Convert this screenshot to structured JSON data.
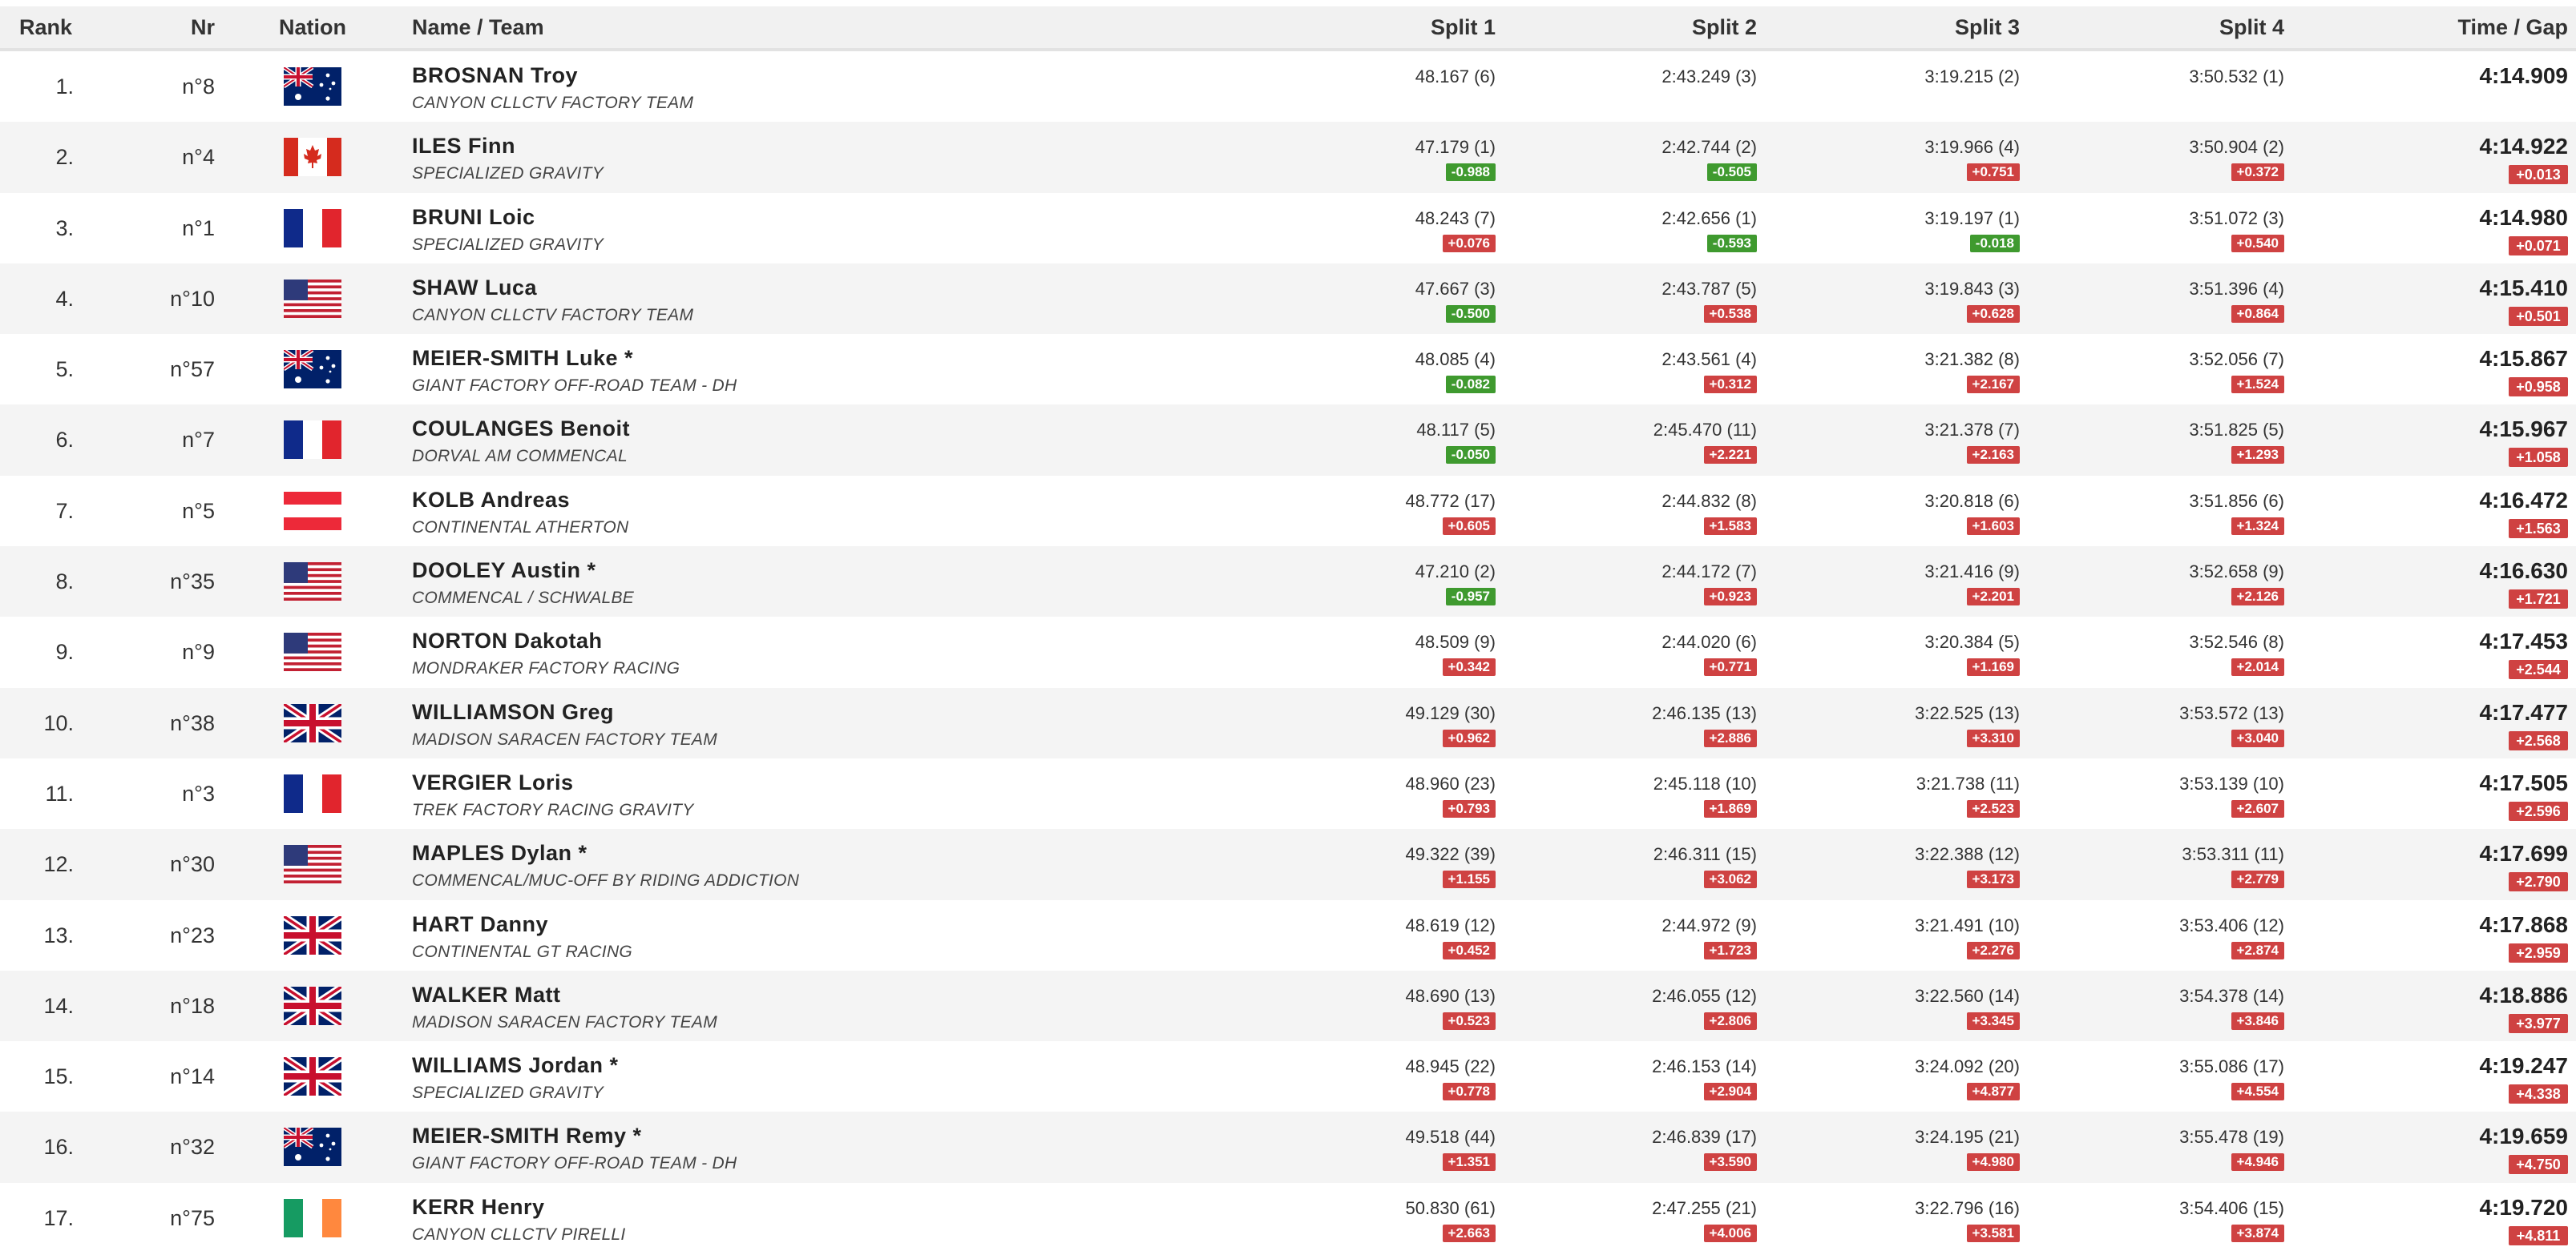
{
  "header": {
    "rank": "Rank",
    "nr": "Nr",
    "nation": "Nation",
    "name_team": "Name / Team",
    "split1": "Split 1",
    "split2": "Split 2",
    "split3": "Split 3",
    "split4": "Split 4",
    "time_gap": "Time / Gap"
  },
  "colors": {
    "gap_negative": "#3f9a2f",
    "gap_positive": "#cf4242",
    "row_alt": "#f4f4f4"
  },
  "rows": [
    {
      "rank": "1.",
      "nr": "n°8",
      "nation": "AUS",
      "name": "BROSNAN Troy",
      "team": "CANYON CLLCTV FACTORY TEAM",
      "s1": "48.167 (6)",
      "g1": "",
      "s2": "2:43.249 (3)",
      "g2": "",
      "s3": "3:19.215 (2)",
      "g3": "",
      "s4": "3:50.532 (1)",
      "g4": "",
      "time": "4:14.909",
      "gap": ""
    },
    {
      "rank": "2.",
      "nr": "n°4",
      "nation": "CAN",
      "name": "ILES Finn",
      "team": "SPECIALIZED GRAVITY",
      "s1": "47.179 (1)",
      "g1": "-0.988",
      "s2": "2:42.744 (2)",
      "g2": "-0.505",
      "s3": "3:19.966 (4)",
      "g3": "+0.751",
      "s4": "3:50.904 (2)",
      "g4": "+0.372",
      "time": "4:14.922",
      "gap": "+0.013"
    },
    {
      "rank": "3.",
      "nr": "n°1",
      "nation": "FRA",
      "name": "BRUNI Loic",
      "team": "SPECIALIZED GRAVITY",
      "s1": "48.243 (7)",
      "g1": "+0.076",
      "s2": "2:42.656 (1)",
      "g2": "-0.593",
      "s3": "3:19.197 (1)",
      "g3": "-0.018",
      "s4": "3:51.072 (3)",
      "g4": "+0.540",
      "time": "4:14.980",
      "gap": "+0.071"
    },
    {
      "rank": "4.",
      "nr": "n°10",
      "nation": "USA",
      "name": "SHAW Luca",
      "team": "CANYON CLLCTV FACTORY TEAM",
      "s1": "47.667 (3)",
      "g1": "-0.500",
      "s2": "2:43.787 (5)",
      "g2": "+0.538",
      "s3": "3:19.843 (3)",
      "g3": "+0.628",
      "s4": "3:51.396 (4)",
      "g4": "+0.864",
      "time": "4:15.410",
      "gap": "+0.501"
    },
    {
      "rank": "5.",
      "nr": "n°57",
      "nation": "AUS",
      "name": "MEIER-SMITH Luke *",
      "team": "GIANT FACTORY OFF-ROAD TEAM - DH",
      "s1": "48.085 (4)",
      "g1": "-0.082",
      "s2": "2:43.561 (4)",
      "g2": "+0.312",
      "s3": "3:21.382 (8)",
      "g3": "+2.167",
      "s4": "3:52.056 (7)",
      "g4": "+1.524",
      "time": "4:15.867",
      "gap": "+0.958"
    },
    {
      "rank": "6.",
      "nr": "n°7",
      "nation": "FRA",
      "name": "COULANGES Benoit",
      "team": "DORVAL AM COMMENCAL",
      "s1": "48.117 (5)",
      "g1": "-0.050",
      "s2": "2:45.470 (11)",
      "g2": "+2.221",
      "s3": "3:21.378 (7)",
      "g3": "+2.163",
      "s4": "3:51.825 (5)",
      "g4": "+1.293",
      "time": "4:15.967",
      "gap": "+1.058"
    },
    {
      "rank": "7.",
      "nr": "n°5",
      "nation": "AUT",
      "name": "KOLB Andreas",
      "team": "CONTINENTAL ATHERTON",
      "s1": "48.772 (17)",
      "g1": "+0.605",
      "s2": "2:44.832 (8)",
      "g2": "+1.583",
      "s3": "3:20.818 (6)",
      "g3": "+1.603",
      "s4": "3:51.856 (6)",
      "g4": "+1.324",
      "time": "4:16.472",
      "gap": "+1.563"
    },
    {
      "rank": "8.",
      "nr": "n°35",
      "nation": "USA",
      "name": "DOOLEY Austin *",
      "team": "COMMENCAL / SCHWALBE",
      "s1": "47.210 (2)",
      "g1": "-0.957",
      "s2": "2:44.172 (7)",
      "g2": "+0.923",
      "s3": "3:21.416 (9)",
      "g3": "+2.201",
      "s4": "3:52.658 (9)",
      "g4": "+2.126",
      "time": "4:16.630",
      "gap": "+1.721"
    },
    {
      "rank": "9.",
      "nr": "n°9",
      "nation": "USA",
      "name": "NORTON Dakotah",
      "team": "MONDRAKER FACTORY RACING",
      "s1": "48.509 (9)",
      "g1": "+0.342",
      "s2": "2:44.020 (6)",
      "g2": "+0.771",
      "s3": "3:20.384 (5)",
      "g3": "+1.169",
      "s4": "3:52.546 (8)",
      "g4": "+2.014",
      "time": "4:17.453",
      "gap": "+2.544"
    },
    {
      "rank": "10.",
      "nr": "n°38",
      "nation": "GBR",
      "name": "WILLIAMSON Greg",
      "team": "MADISON SARACEN FACTORY TEAM",
      "s1": "49.129 (30)",
      "g1": "+0.962",
      "s2": "2:46.135 (13)",
      "g2": "+2.886",
      "s3": "3:22.525 (13)",
      "g3": "+3.310",
      "s4": "3:53.572 (13)",
      "g4": "+3.040",
      "time": "4:17.477",
      "gap": "+2.568"
    },
    {
      "rank": "11.",
      "nr": "n°3",
      "nation": "FRA",
      "name": "VERGIER Loris",
      "team": "TREK FACTORY RACING GRAVITY",
      "s1": "48.960 (23)",
      "g1": "+0.793",
      "s2": "2:45.118 (10)",
      "g2": "+1.869",
      "s3": "3:21.738 (11)",
      "g3": "+2.523",
      "s4": "3:53.139 (10)",
      "g4": "+2.607",
      "time": "4:17.505",
      "gap": "+2.596"
    },
    {
      "rank": "12.",
      "nr": "n°30",
      "nation": "USA",
      "name": "MAPLES Dylan *",
      "team": "COMMENCAL/MUC-OFF BY RIDING ADDICTION",
      "s1": "49.322 (39)",
      "g1": "+1.155",
      "s2": "2:46.311 (15)",
      "g2": "+3.062",
      "s3": "3:22.388 (12)",
      "g3": "+3.173",
      "s4": "3:53.311 (11)",
      "g4": "+2.779",
      "time": "4:17.699",
      "gap": "+2.790"
    },
    {
      "rank": "13.",
      "nr": "n°23",
      "nation": "GBR",
      "name": "HART Danny",
      "team": "CONTINENTAL GT RACING",
      "s1": "48.619 (12)",
      "g1": "+0.452",
      "s2": "2:44.972 (9)",
      "g2": "+1.723",
      "s3": "3:21.491 (10)",
      "g3": "+2.276",
      "s4": "3:53.406 (12)",
      "g4": "+2.874",
      "time": "4:17.868",
      "gap": "+2.959"
    },
    {
      "rank": "14.",
      "nr": "n°18",
      "nation": "GBR",
      "name": "WALKER Matt",
      "team": "MADISON SARACEN FACTORY TEAM",
      "s1": "48.690 (13)",
      "g1": "+0.523",
      "s2": "2:46.055 (12)",
      "g2": "+2.806",
      "s3": "3:22.560 (14)",
      "g3": "+3.345",
      "s4": "3:54.378 (14)",
      "g4": "+3.846",
      "time": "4:18.886",
      "gap": "+3.977"
    },
    {
      "rank": "15.",
      "nr": "n°14",
      "nation": "GBR",
      "name": "WILLIAMS Jordan *",
      "team": "SPECIALIZED GRAVITY",
      "s1": "48.945 (22)",
      "g1": "+0.778",
      "s2": "2:46.153 (14)",
      "g2": "+2.904",
      "s3": "3:24.092 (20)",
      "g3": "+4.877",
      "s4": "3:55.086 (17)",
      "g4": "+4.554",
      "time": "4:19.247",
      "gap": "+4.338"
    },
    {
      "rank": "16.",
      "nr": "n°32",
      "nation": "AUS",
      "name": "MEIER-SMITH Remy *",
      "team": "GIANT FACTORY OFF-ROAD TEAM - DH",
      "s1": "49.518 (44)",
      "g1": "+1.351",
      "s2": "2:46.839 (17)",
      "g2": "+3.590",
      "s3": "3:24.195 (21)",
      "g3": "+4.980",
      "s4": "3:55.478 (19)",
      "g4": "+4.946",
      "time": "4:19.659",
      "gap": "+4.750"
    },
    {
      "rank": "17.",
      "nr": "n°75",
      "nation": "IRL",
      "name": "KERR Henry",
      "team": "CANYON CLLCTV PIRELLI",
      "s1": "50.830 (61)",
      "g1": "+2.663",
      "s2": "2:47.255 (21)",
      "g2": "+4.006",
      "s3": "3:22.796 (16)",
      "g3": "+3.581",
      "s4": "3:54.406 (15)",
      "g4": "+3.874",
      "time": "4:19.720",
      "gap": "+4.811"
    }
  ]
}
